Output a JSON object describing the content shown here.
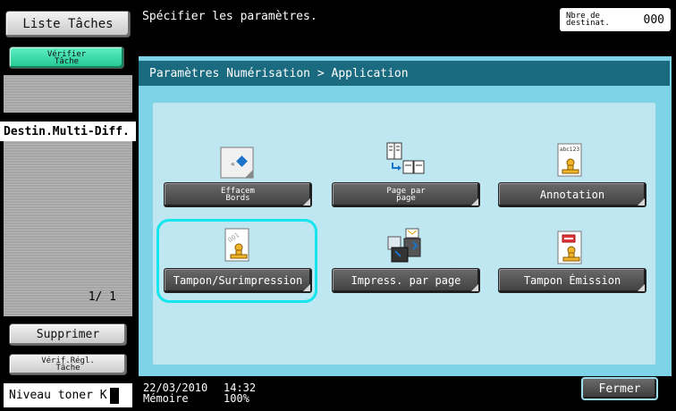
{
  "left_panel": {
    "liste_taches": "Liste Tâches",
    "verifier_tache": [
      "Vérifier",
      "Tâche"
    ],
    "destin_multi_diff": "Destin.Multi-Diff.",
    "pager": "1/  1",
    "supprimer": "Supprimer",
    "verif_regl_tache": [
      "Vérif.Régl.",
      "Tâche"
    ],
    "niveau_toner": "Niveau toner",
    "toner_glyph": "K"
  },
  "header": {
    "instruction": "Spécifier les paramètres.",
    "dest_count_label": [
      "Nbre de",
      "destinat."
    ],
    "dest_count_value": "000"
  },
  "breadcrumb": "Paramètres Numérisation > Application",
  "functions": {
    "effacem_bords": [
      "Effacem",
      "Bords"
    ],
    "page_par_page": [
      "Page par",
      "page"
    ],
    "annotation": "Annotation",
    "tampon_surimpression": "Tampon/Surimpression",
    "impress_par_page": "Impress. par page",
    "tampon_emission": "Tampon Émission",
    "selected": "tampon_surimpression"
  },
  "icons": {
    "effacem_bords": "edge-erase-icon",
    "page_par_page": "page-split-icon",
    "annotation": "annotation-stamp-icon",
    "tampon_surimpression": "stamp-overlay-icon",
    "impress_par_page": "page-print-icon",
    "tampon_emission": "stamp-emission-icon",
    "annotation_sample_text": "abc123"
  },
  "status": {
    "date": "22/03/2010",
    "time": "14:32",
    "memory_label": "Mémoire",
    "memory_value": "100%"
  },
  "fermer": "Fermer",
  "colors": {
    "panel_bg": "#7ed3e9",
    "breadcrumb_bg": "#1b6b80",
    "selection_ring": "#15e5ee",
    "active_task_button": "#21c690"
  }
}
